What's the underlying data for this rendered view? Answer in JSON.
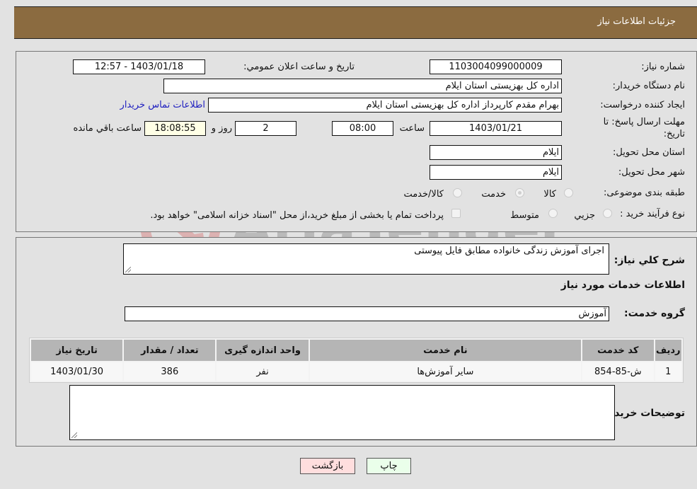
{
  "header": {
    "title": "جزئيات اطلاعات نياز"
  },
  "form": {
    "need_number_label": "شماره نياز:",
    "need_number": "1103004099000009",
    "announce_label": "تاريخ و ساعت اعلان عمومي:",
    "announce_value": "1403/01/18 - 12:57",
    "buyer_org_label": "نام دستگاه خريدار:",
    "buyer_org": "اداره کل بهزیستی استان ایلام",
    "creator_label": "ايجاد کننده درخواست:",
    "creator": "بهرام مقدم کارپرداز اداره کل بهزیستی استان ایلام",
    "contact_link": "اطلاعات تماس خريدار",
    "deadline_label_line1": "مهلت ارسال پاسخ: تا",
    "deadline_label_line2": "تاريخ:",
    "deadline_date": "1403/01/21",
    "time_label": "ساعت",
    "deadline_time": "08:00",
    "days_value": "2",
    "days_label": "روز و",
    "remaining_time": "18:08:55",
    "remaining_label": "ساعت باقي مانده",
    "province_label": "استان محل تحويل:",
    "province": "ایلام",
    "city_label": "شهر محل تحويل:",
    "city": "ایلام",
    "category_label": "طبقه بندی موضوعی:",
    "category_options": [
      "کالا",
      "خدمت",
      "کالا/خدمت"
    ],
    "category_selected": "خدمت",
    "process_label": "نوع فرآيند خريد :",
    "process_options": [
      "جزيي",
      "متوسط"
    ],
    "treasury_note": "پرداخت تمام يا بخشی از مبلغ خريد،از محل \"اسناد خزانه اسلامی\" خواهد بود."
  },
  "details": {
    "description_label": "شرح کلي نياز:",
    "description": "اجرای آموزش زندگی خانواده مطابق فایل پیوستی",
    "services_heading": "اطلاعات خدمات مورد نياز",
    "service_group_label": "گروه خدمت:",
    "service_group": "آموزش",
    "table": {
      "headers": [
        "رديف",
        "کد خدمت",
        "نام خدمت",
        "واحد اندازه گيری",
        "تعداد / مقدار",
        "تاريخ نياز"
      ],
      "rows": [
        [
          "1",
          "ش-85-854",
          "سایر آموزش‌ها",
          "نفر",
          "386",
          "1403/01/30"
        ]
      ]
    },
    "buyer_notes_label": "توضيحات خريدار:",
    "buyer_notes": ""
  },
  "buttons": {
    "print": "چاپ",
    "back": "بازگشت"
  },
  "watermark": {
    "text": "AriaTender.neT"
  },
  "colors": {
    "header_bg": "#8b6b40",
    "print_bg": "#eaffea",
    "back_bg": "#ffdede",
    "link": "#2020c0"
  }
}
